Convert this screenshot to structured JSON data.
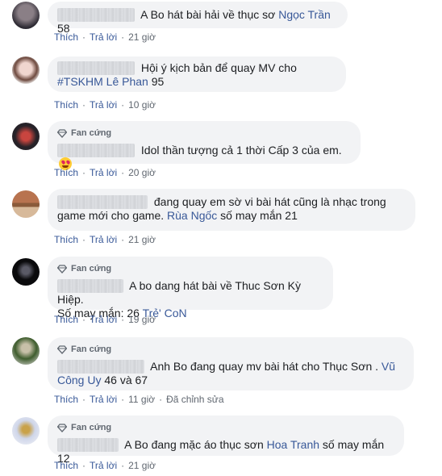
{
  "actions": {
    "like": "Thích",
    "reply": "Trả lời",
    "edited": "Đã chỉnh sửa"
  },
  "badge_label": "Fan cứng",
  "comments": [
    {
      "text": "A Bo hát bài hải về thục sơ",
      "tag": "Ngọc Trần",
      "suffix": " 58",
      "time": "21 giờ"
    },
    {
      "text": "Hội ý kịch bản để quay MV cho",
      "tag": "#TSKHM Lê Phan",
      "suffix": " 95",
      "time": "10 giờ"
    },
    {
      "text": "Idol thần tượng cả 1 thời Cấp 3 của em.",
      "emoji": "heart-eyes-emoji",
      "time": "20 giờ"
    },
    {
      "text_a": "đang quay em sờ vi bài hát cũng là nhạc trong",
      "text_b": "game mới cho game.",
      "tag": "Rùa Ngốc",
      "suffix": " số may mắn 21",
      "time": "21 giờ"
    },
    {
      "text_a": "A bo dang hát bài về Thuc Sơn Kỳ Hiệp.",
      "text_b": "Số may mắn: 26",
      "tag": "Trẻ' CoN",
      "time": "19 giờ"
    },
    {
      "text_a": "Anh Bo đang quay mv bài hát cho Thục Sơn .",
      "tag_a": "Vũ",
      "tag_b": "Công Uy",
      "suffix": " 46 và 67",
      "time": "11 giờ"
    },
    {
      "text": "A Bo đang mặc áo thục sơn",
      "tag": "Hoa Tranh",
      "suffix": " số may mắn 12",
      "time": "21 giờ"
    }
  ]
}
